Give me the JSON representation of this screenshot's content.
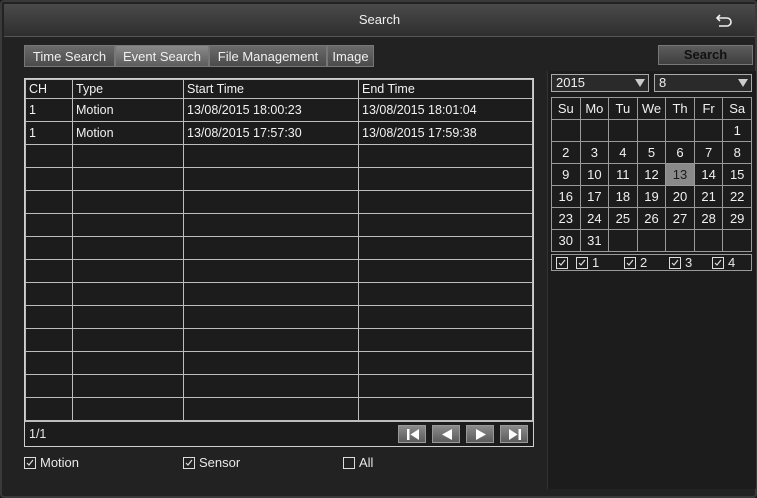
{
  "window": {
    "title": "Search"
  },
  "tabs": [
    "Time Search",
    "Event Search",
    "File Management",
    "Image"
  ],
  "active_tab": "Event Search",
  "search_button": "Search",
  "table": {
    "columns": [
      "CH",
      "Type",
      "Start Time",
      "End Time"
    ],
    "rows": [
      [
        "1",
        "Motion",
        "13/08/2015 18:00:23",
        "13/08/2015 18:01:04"
      ],
      [
        "1",
        "Motion",
        "13/08/2015 17:57:30",
        "13/08/2015 17:59:38"
      ]
    ]
  },
  "pager": {
    "page": "1/1"
  },
  "filters": [
    {
      "label": "Motion",
      "checked": true
    },
    {
      "label": "Sensor",
      "checked": true
    },
    {
      "label": "All",
      "checked": false
    }
  ],
  "calendar": {
    "year": "2015",
    "month": "8",
    "weekdays": [
      "Su",
      "Mo",
      "Tu",
      "We",
      "Th",
      "Fr",
      "Sa"
    ],
    "weeks": [
      [
        "",
        "",
        "",
        "",
        "",
        "",
        "1"
      ],
      [
        "2",
        "3",
        "4",
        "5",
        "6",
        "7",
        "8"
      ],
      [
        "9",
        "10",
        "11",
        "12",
        "13",
        "14",
        "15"
      ],
      [
        "16",
        "17",
        "18",
        "19",
        "20",
        "21",
        "22"
      ],
      [
        "23",
        "24",
        "25",
        "26",
        "27",
        "28",
        "29"
      ],
      [
        "30",
        "31",
        "",
        "",
        "",
        "",
        ""
      ]
    ],
    "selected_day": "13",
    "channels": [
      {
        "label": "",
        "checked": true
      },
      {
        "label": "1",
        "checked": true
      },
      {
        "label": "2",
        "checked": true
      },
      {
        "label": "3",
        "checked": true
      },
      {
        "label": "4",
        "checked": true
      }
    ]
  }
}
